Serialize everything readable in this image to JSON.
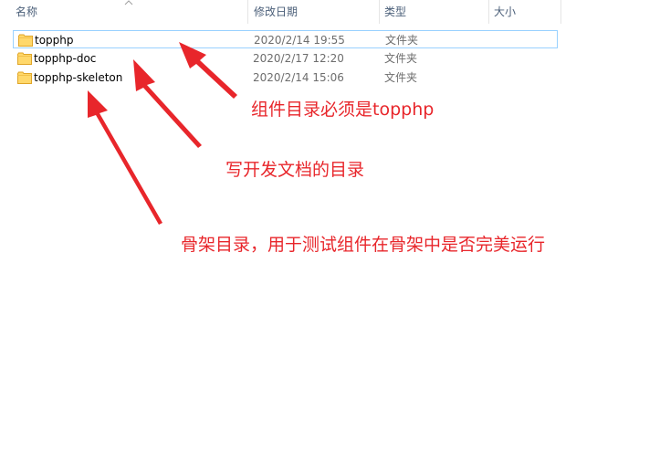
{
  "header": {
    "columns": [
      {
        "key": "name",
        "label": "名称"
      },
      {
        "key": "date",
        "label": "修改日期"
      },
      {
        "key": "type",
        "label": "类型"
      },
      {
        "key": "size",
        "label": "大小"
      }
    ],
    "sort_icon": "sort-ascending-caret-icon"
  },
  "files": [
    {
      "name": "topphp",
      "date": "2020/2/14 19:55",
      "type": "文件夹",
      "icon": "folder-icon",
      "focused": true
    },
    {
      "name": "topphp-doc",
      "date": "2020/2/17 12:20",
      "type": "文件夹",
      "icon": "folder-icon",
      "focused": false
    },
    {
      "name": "topphp-skeleton",
      "date": "2020/2/14 15:06",
      "type": "文件夹",
      "icon": "folder-icon",
      "focused": false
    }
  ],
  "annotations": [
    {
      "text": "组件目录必须是topphp",
      "points_to": "topphp"
    },
    {
      "text": "写开发文档的目录",
      "points_to": "topphp-doc"
    },
    {
      "text": "骨架目录，用于测试组件在骨架中是否完美运行",
      "points_to": "topphp-skeleton"
    }
  ],
  "colors": {
    "annotation": "#e8262b",
    "folder_body": "#ffd86b",
    "folder_edge": "#e0a526",
    "focus_border": "#99d1ff",
    "header_text": "#4c607a",
    "meta_text": "#6d6d6d"
  }
}
